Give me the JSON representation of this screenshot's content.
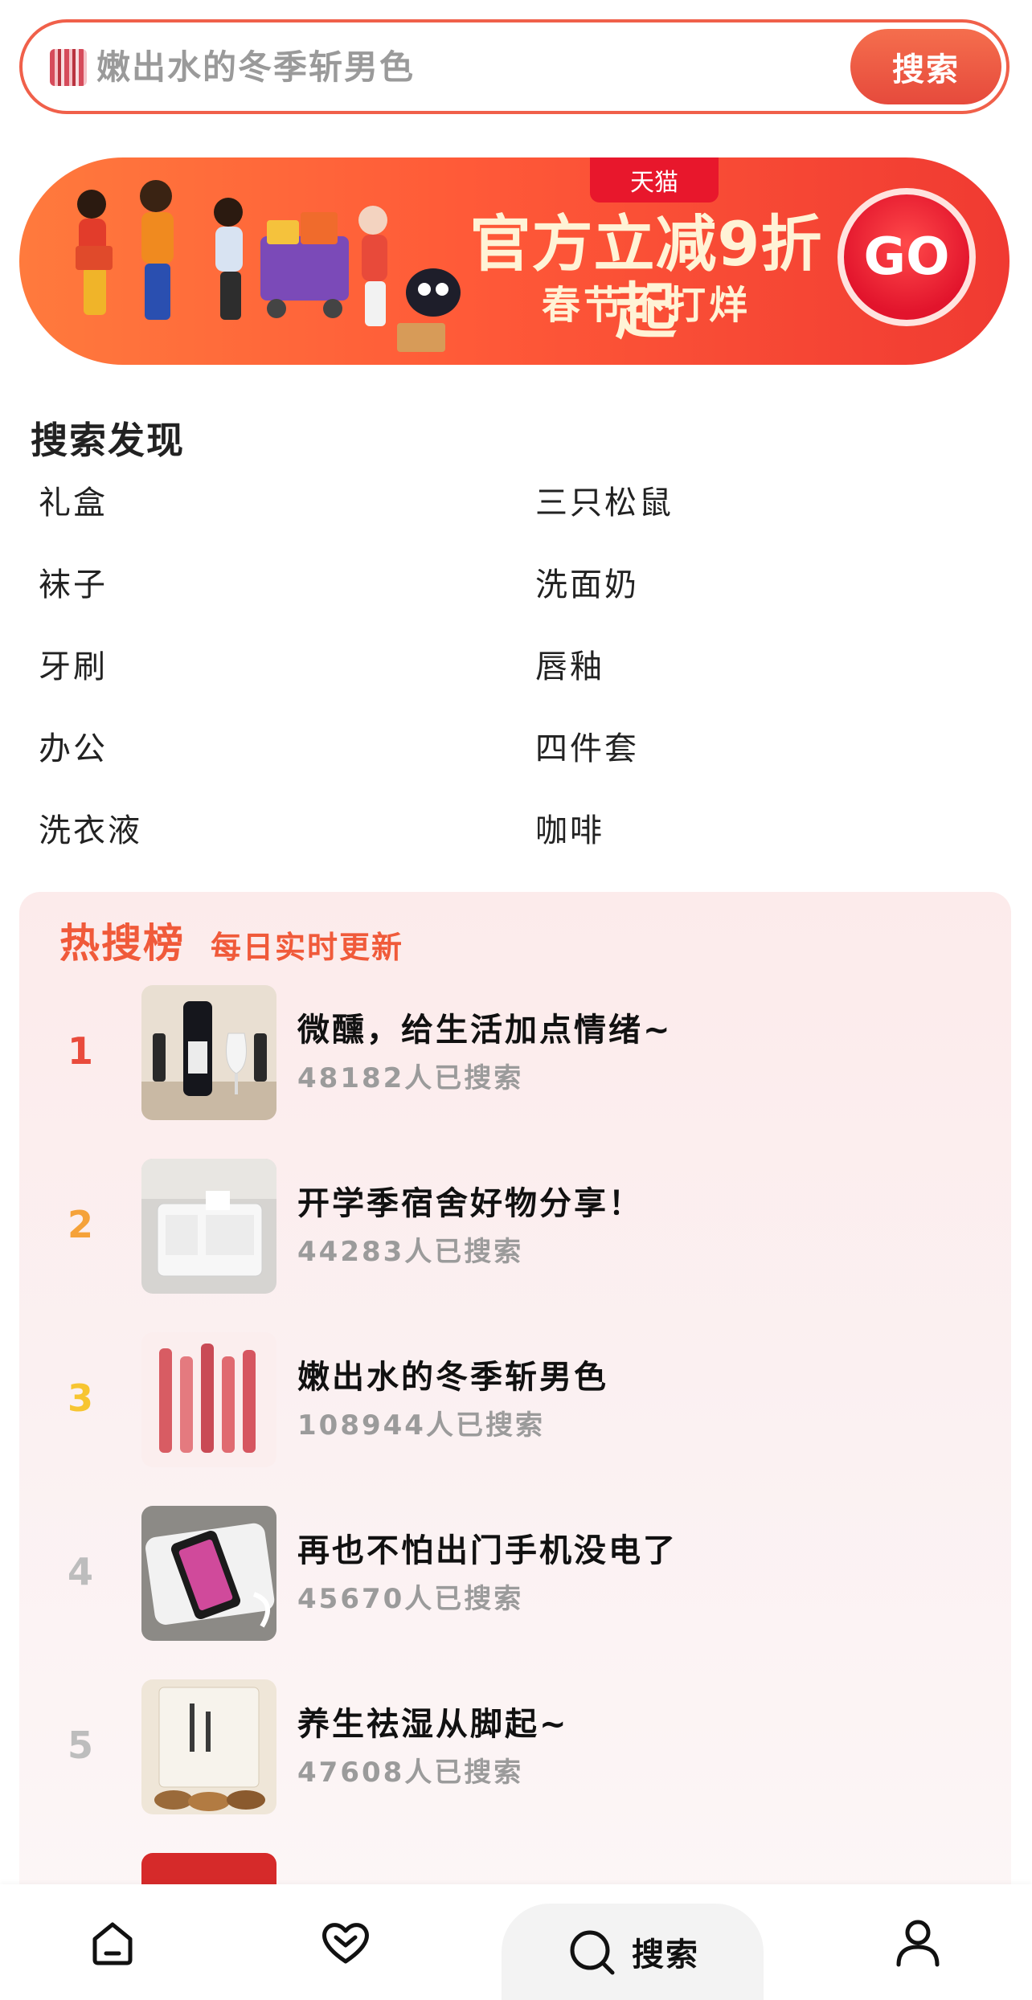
{
  "search": {
    "placeholder": "嫩出水的冬季斩男色",
    "button_label": "搜索"
  },
  "banner": {
    "tag": "天猫",
    "headline": "官方立减9折起",
    "subline": "春节不打烊",
    "go_label": "GO"
  },
  "discovery": {
    "title": "搜索发现",
    "items": [
      "礼盒",
      "三只松鼠",
      "袜子",
      "洗面奶",
      "牙刷",
      "唇釉",
      "办公",
      "四件套",
      "洗衣液",
      "咖啡"
    ]
  },
  "hot": {
    "title": "热搜榜",
    "subtitle": "每日实时更新",
    "items": [
      {
        "rank": "1",
        "name": "微醺，给生活加点情绪~",
        "count": "48182人已搜索",
        "rank_color": "#e94b3c"
      },
      {
        "rank": "2",
        "name": "开学季宿舍好物分享！",
        "count": "44283人已搜索",
        "rank_color": "#f5a23a"
      },
      {
        "rank": "3",
        "name": "嫩出水的冬季斩男色",
        "count": "108944人已搜索",
        "rank_color": "#f7c531"
      },
      {
        "rank": "4",
        "name": "再也不怕出门手机没电了",
        "count": "45670人已搜索",
        "rank_color": "#bdbdbd"
      },
      {
        "rank": "5",
        "name": "养生祛湿从脚起~",
        "count": "47608人已搜索",
        "rank_color": "#bdbdbd"
      }
    ]
  },
  "nav": {
    "items": [
      {
        "icon": "home-icon"
      },
      {
        "icon": "heart-icon"
      },
      {
        "icon": "search-icon",
        "label": "搜索"
      },
      {
        "icon": "user-icon"
      }
    ]
  },
  "colors": {
    "accent": "#f0604a",
    "hot_text": "#f05a3a"
  }
}
